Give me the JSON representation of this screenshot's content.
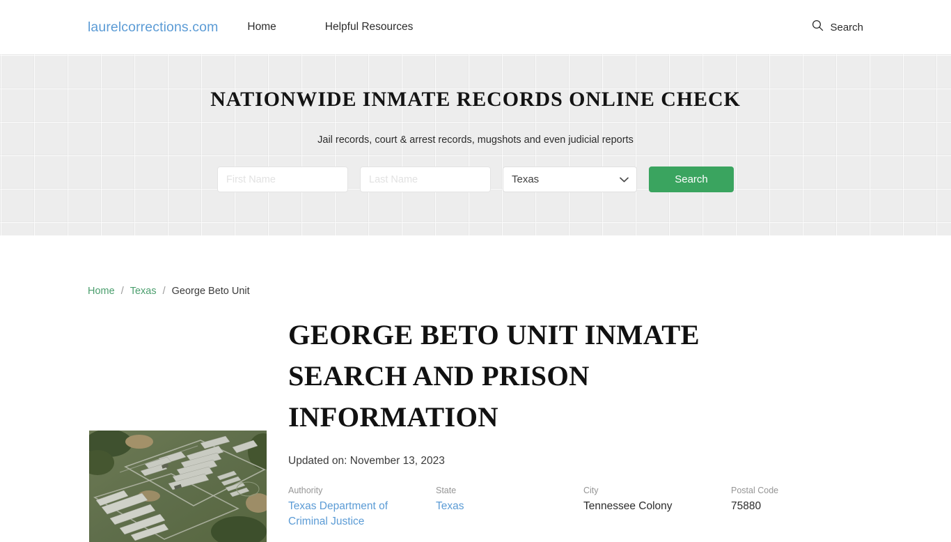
{
  "header": {
    "logo": "laurelcorrections.com",
    "nav": [
      {
        "label": "Home"
      },
      {
        "label": "Helpful Resources"
      }
    ],
    "search_label": "Search",
    "search_icon": "magnifier-icon"
  },
  "hero": {
    "title": "NATIONWIDE INMATE RECORDS ONLINE CHECK",
    "subtitle": "Jail records, court & arrest records, mugshots and even judicial reports",
    "form": {
      "first_name_value": "",
      "first_name_placeholder": "First Name",
      "last_name_value": "",
      "last_name_placeholder": "Last Name",
      "state_selected": "Texas",
      "state_options": [
        "Texas"
      ],
      "submit_label": "Search",
      "submit_color": "#3aa45f"
    }
  },
  "breadcrumb": {
    "items": [
      {
        "label": "Home",
        "link": true
      },
      {
        "label": "Texas",
        "link": true
      },
      {
        "label": "George Beto Unit",
        "link": false
      }
    ],
    "separator": "/",
    "link_color": "#4a9e6d"
  },
  "article": {
    "title": "George Beto Unit Inmate Search and Prison Information",
    "updated": "Updated on: November 13, 2023",
    "image_alt": "aerial-photo-of-george-beto-unit",
    "meta": [
      {
        "label": "Authority",
        "value": "Texas Department of Criminal Justice",
        "link": true
      },
      {
        "label": "State",
        "value": "Texas",
        "link": true
      },
      {
        "label": "City",
        "value": "Tennessee Colony",
        "link": false
      },
      {
        "label": "Postal Code",
        "value": "75880",
        "link": false
      }
    ]
  }
}
